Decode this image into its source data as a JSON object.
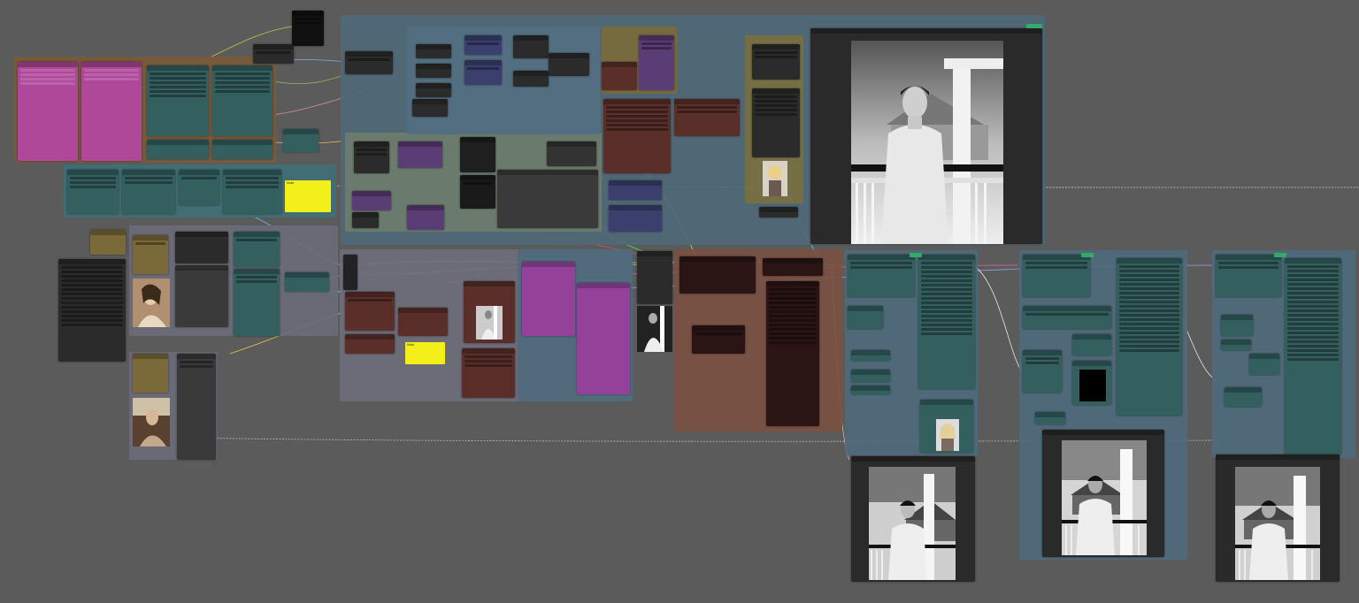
{
  "app": {
    "title": ""
  },
  "colors": {
    "canvas": "#5b5b5b",
    "node_teal": "#335f5f",
    "node_dark": "#2b2b2b",
    "node_brown": "#5a2f2a",
    "node_purple": "#5b3d75",
    "node_navy": "#3a3f6e",
    "group_orange": "#7a5a3a",
    "group_pink": "#b04a9a",
    "group_bluegrey": "#4f6a7a",
    "group_sage": "#6a7a6a",
    "group_grey": "#6a6a78",
    "note_yellow": "#f2ef1a",
    "badge_green": "#3a9a5a"
  },
  "notes": {
    "yellow_1": "Note",
    "yellow_2": "Note"
  },
  "icons": {
    "collapse": "triangle-icon",
    "badge": "badge-icon"
  }
}
